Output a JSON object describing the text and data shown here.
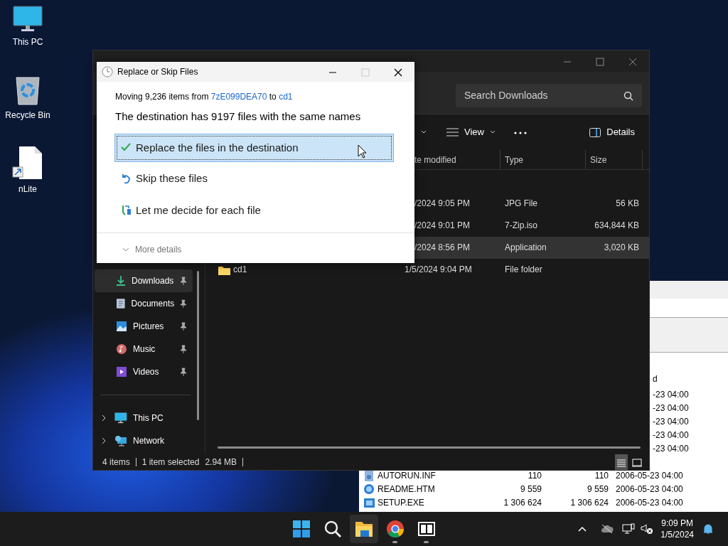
{
  "desktop_icons": [
    {
      "label": "This PC",
      "kind": "pc"
    },
    {
      "label": "Recycle Bin",
      "kind": "bin"
    },
    {
      "label": "nLite",
      "kind": "shortcut"
    }
  ],
  "back_window": {
    "header_fragment": "d",
    "date_fragments": [
      "-23 04:00",
      "-23 04:00",
      "-23 04:00",
      "-23 04:00",
      "-23 04:00"
    ],
    "rows": [
      {
        "kind": "inf",
        "name": "AUTORUN.INF",
        "size": "110",
        "packed": "110",
        "modified": "2006-05-23 04:00"
      },
      {
        "kind": "htm",
        "name": "README.HTM",
        "size": "9 559",
        "packed": "9 559",
        "modified": "2006-05-23 04:00"
      },
      {
        "kind": "exe",
        "name": "SETUP.EXE",
        "size": "1 306 624",
        "packed": "1 306 624",
        "modified": "2006-05-23 04:00"
      }
    ]
  },
  "explorer": {
    "search": {
      "placeholder": "Search Downloads"
    },
    "toolbar": {
      "view": "View",
      "details": "Details"
    },
    "columns": [
      "te modified",
      "Type",
      "Size"
    ],
    "rows": [
      {
        "date": "/2024 9:05 PM",
        "type": "JPG File",
        "size": "56 KB",
        "selected": false
      },
      {
        "date": "/2024 9:01 PM",
        "type": "7-Zip.iso",
        "size": "634,844 KB",
        "selected": false
      },
      {
        "date": "/2024 8:56 PM",
        "type": "Application",
        "size": "3,020 KB",
        "selected": true
      },
      {
        "name": "cd1",
        "date": "1/5/2024 9:04 PM",
        "type": "File folder",
        "selected": false
      }
    ],
    "quick_access": [
      {
        "label": "Downloads",
        "kind": "downloads",
        "selected": true
      },
      {
        "label": "Documents",
        "kind": "documents",
        "selected": false
      },
      {
        "label": "Pictures",
        "kind": "pictures",
        "selected": false
      },
      {
        "label": "Music",
        "kind": "music",
        "selected": false
      },
      {
        "label": "Videos",
        "kind": "videos",
        "selected": false
      }
    ],
    "roots": [
      {
        "label": "This PC",
        "kind": "pc"
      },
      {
        "label": "Network",
        "kind": "network"
      }
    ],
    "status": {
      "count": "4 items",
      "selection": "1 item selected",
      "size": "2.94 MB"
    }
  },
  "dialog": {
    "title": "Replace or Skip Files",
    "maximize_enabled": false,
    "summary": {
      "prefix": "Moving 9,236 items from",
      "source": "7zE099DEA70",
      "middle": "to",
      "target": "cd1"
    },
    "heading": "The destination has 9197 files with the same names",
    "options": [
      {
        "kind": "replace",
        "label": "Replace the files in the destination",
        "selected": true
      },
      {
        "kind": "skip",
        "label": "Skip these files",
        "selected": false
      },
      {
        "kind": "decide",
        "label": "Let me decide for each file",
        "selected": false
      }
    ],
    "more_details": "More details"
  },
  "taskbar": {
    "apps": [
      {
        "kind": "start",
        "running": false,
        "active": false
      },
      {
        "kind": "search",
        "running": false,
        "active": false
      },
      {
        "kind": "explorer",
        "running": false,
        "active": true
      },
      {
        "kind": "chrome",
        "running": true,
        "active": false
      },
      {
        "kind": "sevenzip",
        "running": true,
        "active": false
      }
    ],
    "time": "9:09 PM",
    "date": "1/5/2024"
  }
}
